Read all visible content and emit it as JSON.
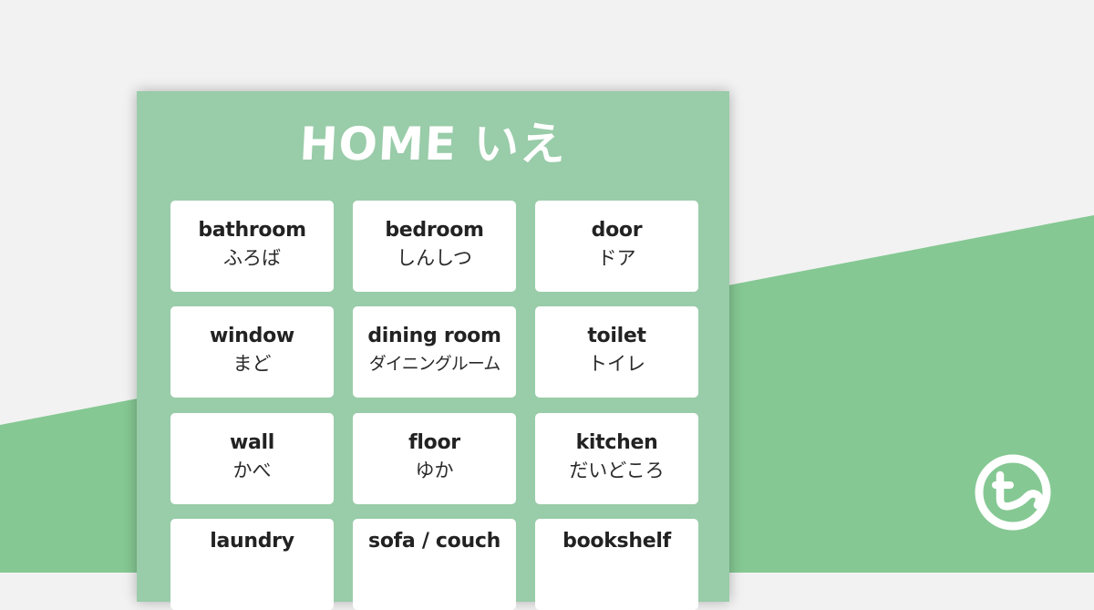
{
  "colors": {
    "background_light": "#f2f2f2",
    "background_green": "#85c893",
    "poster_green": "#99cca9",
    "card": "#ffffff",
    "text": "#222222",
    "title": "#ffffff"
  },
  "poster": {
    "title": "HOME いえ",
    "cards": [
      {
        "en": "bathroom",
        "jp": "ふろば"
      },
      {
        "en": "bedroom",
        "jp": "しんしつ"
      },
      {
        "en": "door",
        "jp": "ドア"
      },
      {
        "en": "window",
        "jp": "まど"
      },
      {
        "en": "dining room",
        "jp": "ダイニングルーム"
      },
      {
        "en": "toilet",
        "jp": "トイレ"
      },
      {
        "en": "wall",
        "jp": "かべ"
      },
      {
        "en": "floor",
        "jp": "ゆか"
      },
      {
        "en": "kitchen",
        "jp": "だいどころ"
      },
      {
        "en": "laundry",
        "jp": ""
      },
      {
        "en": "sofa / couch",
        "jp": ""
      },
      {
        "en": "bookshelf",
        "jp": ""
      }
    ]
  },
  "brand": {
    "logo_icon": "teach-starter-t-logo"
  }
}
